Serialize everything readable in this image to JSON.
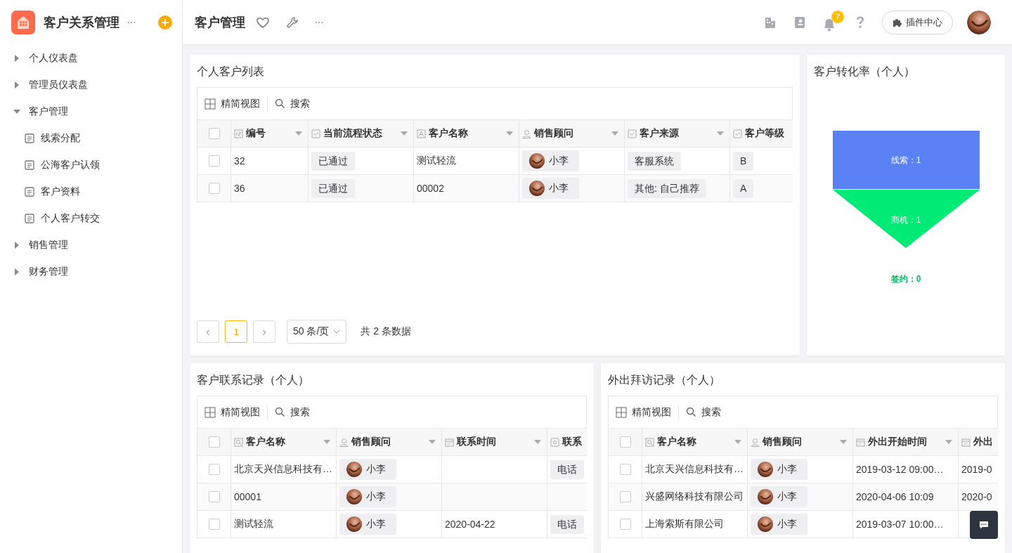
{
  "app": {
    "title": "客户关系管理",
    "more": "···"
  },
  "sidebar": {
    "items": [
      {
        "label": "个人仪表盘",
        "kind": "group",
        "expanded": false
      },
      {
        "label": "管理员仪表盘",
        "kind": "group",
        "expanded": false
      },
      {
        "label": "客户管理",
        "kind": "group",
        "expanded": true,
        "children": [
          {
            "label": "线索分配",
            "kind": "page"
          },
          {
            "label": "公海客户认领",
            "kind": "page"
          },
          {
            "label": "客户资料",
            "kind": "page"
          },
          {
            "label": "个人客户转交",
            "kind": "page"
          }
        ]
      },
      {
        "label": "销售管理",
        "kind": "group",
        "expanded": false
      },
      {
        "label": "财务管理",
        "kind": "group",
        "expanded": false
      }
    ]
  },
  "header": {
    "title": "客户管理",
    "more": "···",
    "badge": "7",
    "plugin_button": "插件中心"
  },
  "panels": [
    {
      "title": "个人客户列表",
      "view": "精简视图",
      "search": "搜索",
      "all_checked": false,
      "columns": [
        {
          "label": "编号",
          "kind": "number",
          "menu": true
        },
        {
          "label": "当前流程状态",
          "kind": "select",
          "menu": true
        },
        {
          "label": "客户名称",
          "kind": "text",
          "menu": true
        },
        {
          "label": "销售顾问",
          "kind": "member",
          "menu": true
        },
        {
          "label": "客户来源",
          "kind": "select",
          "menu": true
        },
        {
          "label": "客户等级",
          "kind": "select",
          "menu": false
        }
      ],
      "rows": [
        {
          "checked": false,
          "cells": [
            "32",
            "已通过",
            "测试轻流",
            "小李",
            "客服系统",
            "B"
          ]
        },
        {
          "checked": false,
          "cells": [
            "36",
            "已通过",
            "00002",
            "小李",
            "其他: 自己推荐",
            "A"
          ]
        }
      ],
      "pagination": {
        "prev": "‹",
        "pages": [
          {
            "label": "1",
            "selected": true
          }
        ],
        "next": "›",
        "page_size": "50 条/页",
        "total": "共 2 条数据"
      }
    },
    {
      "title": "客户转化率（个人）",
      "funnel": [
        {
          "label": "线索：1",
          "color": "#5b82f4"
        },
        {
          "label": "商机：1",
          "color": "#00eb75"
        },
        {
          "label": "签约：0",
          "color": "#00c060"
        }
      ]
    },
    {
      "title": "客户联系记录（个人）",
      "view": "精简视图",
      "search": "搜索",
      "all_checked": false,
      "columns": [
        {
          "label": "客户名称",
          "kind": "relation",
          "menu": true
        },
        {
          "label": "销售顾问",
          "kind": "member",
          "menu": true
        },
        {
          "label": "联系时间",
          "kind": "date",
          "menu": true
        },
        {
          "label": "联系",
          "kind": "option",
          "menu": false
        }
      ],
      "rows": [
        {
          "checked": false,
          "cells": [
            "北京天兴信息科技有…",
            "小李",
            "",
            "电话"
          ]
        },
        {
          "checked": false,
          "cells": [
            "00001",
            "小李",
            "",
            ""
          ]
        },
        {
          "checked": false,
          "cells": [
            "测试轻流",
            "小李",
            "2020-04-22",
            "电话"
          ]
        }
      ]
    },
    {
      "title": "外出拜访记录（个人）",
      "view": "精简视图",
      "search": "搜索",
      "all_checked": false,
      "columns": [
        {
          "label": "客户名称",
          "kind": "relation",
          "menu": true
        },
        {
          "label": "销售顾问",
          "kind": "member",
          "menu": true
        },
        {
          "label": "外出开始时间",
          "kind": "date",
          "menu": true
        },
        {
          "label": "外出",
          "kind": "date",
          "menu": false
        }
      ],
      "rows": [
        {
          "checked": false,
          "cells": [
            "北京天兴信息科技有…",
            "小李",
            "2019-03-12 09:00…",
            "2019-0"
          ]
        },
        {
          "checked": false,
          "cells": [
            "兴盛网络科技有限公司",
            "小李",
            "2020-04-06 10:09",
            "2020-0"
          ]
        },
        {
          "checked": false,
          "cells": [
            "上海索斯有限公司",
            "小李",
            "2019-03-07 10:00…",
            ""
          ]
        }
      ]
    }
  ]
}
